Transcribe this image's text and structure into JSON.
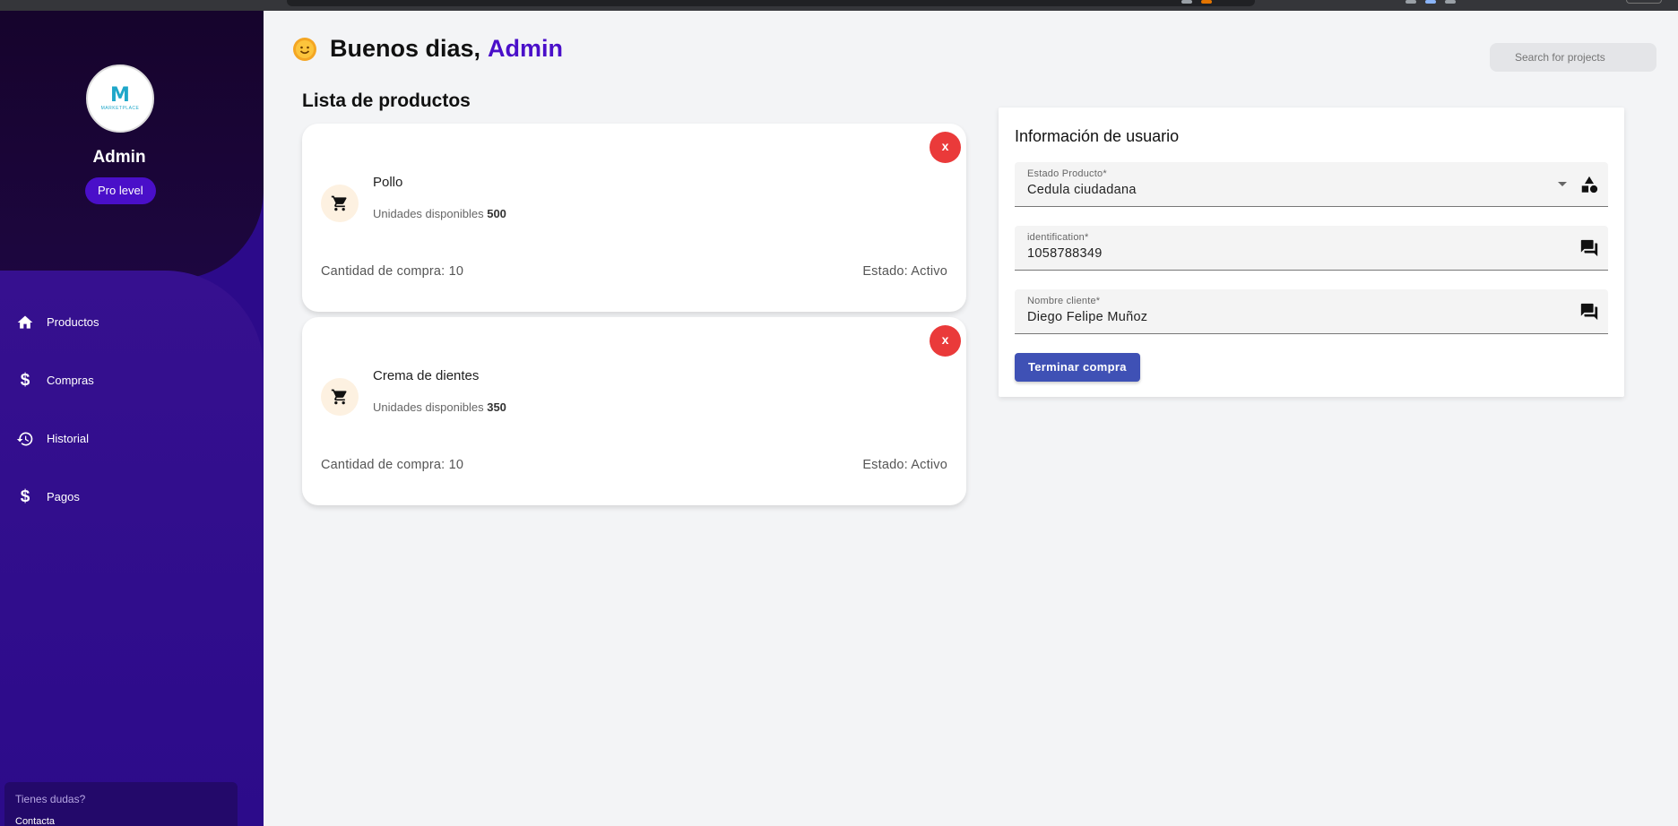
{
  "sidebar": {
    "user_name": "Admin",
    "badge": "Pro level",
    "logo_text": "MARKETPLACE",
    "nav": [
      {
        "label": "Productos",
        "icon": "home-icon"
      },
      {
        "label": "Compras",
        "icon": "dollar-icon"
      },
      {
        "label": "Historial",
        "icon": "history-icon"
      },
      {
        "label": "Pagos",
        "icon": "dollar-icon"
      }
    ],
    "help_title": "Tienes dudas?",
    "help_link": "Contacta"
  },
  "header": {
    "greeting": "Buenos dias,",
    "user": "Admin",
    "search_placeholder": "Search for projects"
  },
  "products": {
    "title": "Lista de productos",
    "items": [
      {
        "name": "Pollo",
        "stock_label": "Unidades disponibles",
        "stock": "500",
        "quantity": "Cantidad de compra: 10",
        "status": "Estado: Activo",
        "remove": "x"
      },
      {
        "name": "Crema de dientes",
        "stock_label": "Unidades disponibles",
        "stock": "350",
        "quantity": "Cantidad de compra: 10",
        "status": "Estado: Activo",
        "remove": "x"
      }
    ]
  },
  "user_info": {
    "title": "Información de usuario",
    "fields": [
      {
        "label": "Estado Producto*",
        "value": "Cedula ciudadana",
        "icon": "shapes-icon"
      },
      {
        "label": "identification*",
        "value": "1058788349",
        "icon": "chat-icon"
      },
      {
        "label": "Nombre cliente*",
        "value": "Diego Felipe Muñoz",
        "icon": "chat-icon"
      }
    ],
    "submit": "Terminar compra"
  },
  "colors": {
    "accent": "#4a0fc9",
    "sidebar": "#2c0a8a",
    "danger": "#ea3a3a",
    "button": "#3f51b5"
  }
}
